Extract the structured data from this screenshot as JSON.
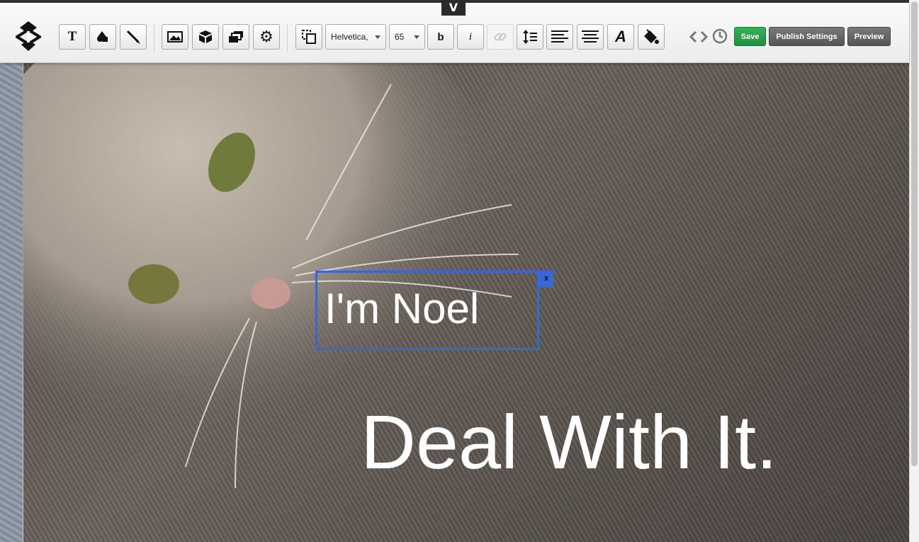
{
  "toolbar": {
    "collapse_glyph": "V",
    "font_family": "Helvetica,",
    "font_size": "65",
    "bold_label": "b",
    "italic_label": "i",
    "text_tool_label": "T",
    "font_style_label": "A",
    "save_label": "Save",
    "publish_label": "Publish Settings",
    "preview_label": "Preview",
    "accent_green": "#2aa34b",
    "icons": [
      "logo-icon",
      "text-tool-icon",
      "shapes-icon",
      "pen-icon",
      "image-icon",
      "widget-icon",
      "layers-icon",
      "gear-icon",
      "duplicate-icon",
      "link-icon",
      "line-height-icon",
      "align-left-icon",
      "align-center-icon",
      "font-style-icon",
      "fill-bucket-icon",
      "code-icon",
      "history-icon"
    ]
  },
  "canvas": {
    "selected_text": "I'm Noel",
    "close_label": "x",
    "headline": "Deal With It.",
    "selection_color": "#3766d6"
  }
}
